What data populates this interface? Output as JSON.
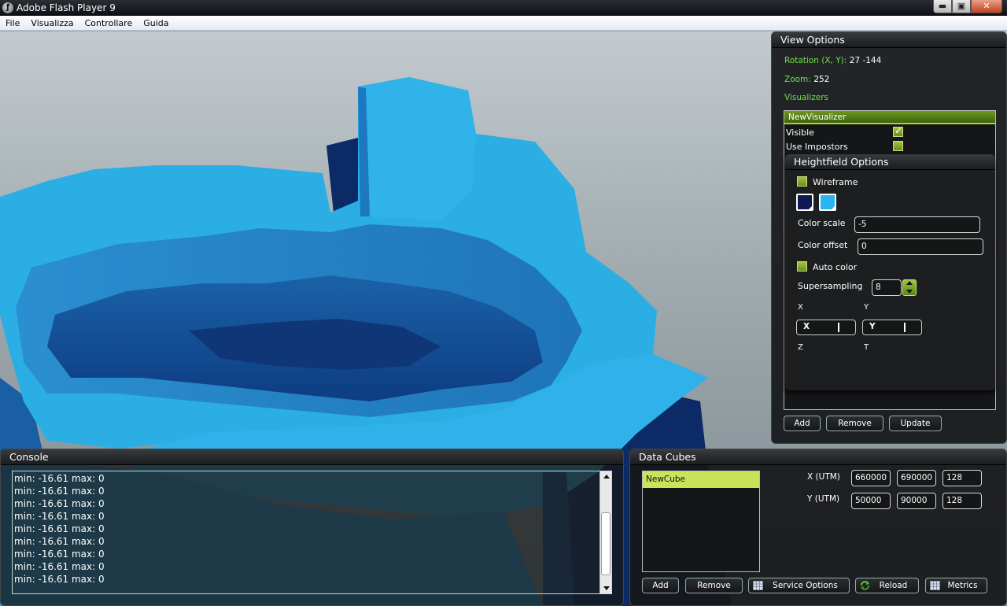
{
  "window": {
    "title": "Adobe Flash Player 9",
    "min": "▬",
    "max": "▣",
    "close": "✕"
  },
  "menu": [
    "File",
    "Visualizza",
    "Controllare",
    "Guida"
  ],
  "view_options": {
    "title": "View Options",
    "rotation_label": "Rotation (X, Y):",
    "rotation_value": "27 -144",
    "zoom_label": "Zoom:",
    "zoom_value": "252",
    "visualizers_label": "Visualizers",
    "visualizer_name": "NewVisualizer",
    "visible_label": "Visible",
    "visible_checked": true,
    "impostors_label": "Use Impostors",
    "impostors_checked": false,
    "buttons": {
      "add": "Add",
      "remove": "Remove",
      "update": "Update"
    }
  },
  "heightfield": {
    "title": "Heightfield Options",
    "wireframe_label": "Wireframe",
    "color_low": "#0e1a52",
    "color_high": "#29b6f0",
    "color_scale_label": "Color scale",
    "color_scale_value": "-5",
    "color_offset_label": "Color offset",
    "color_offset_value": "0",
    "auto_color_label": "Auto color",
    "supersampling_label": "Supersampling",
    "supersampling_value": "8",
    "x_label": "X",
    "y_label": "Y",
    "x_slider": "X",
    "y_slider": "Y",
    "z_label": "Z",
    "t_label": "T"
  },
  "console": {
    "title": "Console",
    "lines": [
      "min: -16.61 max: 0",
      "min: -16.61 max: 0",
      "min: -16.61 max: 0",
      "min: -16.61 max: 0",
      "min: -16.61 max: 0",
      "min: -16.61 max: 0",
      "min: -16.61 max: 0",
      "min: -16.61 max: 0",
      "min: -16.61 max: 0"
    ]
  },
  "data_cubes": {
    "title": "Data Cubes",
    "items": [
      "NewCube"
    ],
    "x_label": "X (UTM)",
    "x_values": [
      "660000",
      "690000",
      "128"
    ],
    "y_label": "Y (UTM)",
    "y_values": [
      "50000",
      "90000",
      "128"
    ],
    "buttons": {
      "add": "Add",
      "remove": "Remove",
      "service_options": "Service Options",
      "reload": "Reload",
      "metrics": "Metrics"
    }
  }
}
